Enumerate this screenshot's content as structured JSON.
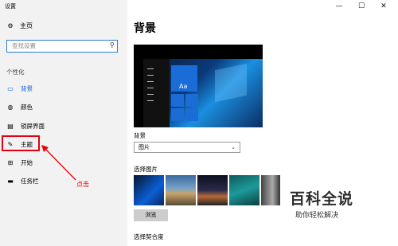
{
  "window": {
    "title": "设置",
    "min": "—",
    "max": "☐",
    "close": "✕"
  },
  "sidebar": {
    "home_label": "主页",
    "search_placeholder": "查找设置",
    "section_label": "个性化",
    "items": [
      {
        "label": "背景",
        "icon": "image-icon",
        "glyph": "▭"
      },
      {
        "label": "颜色",
        "icon": "palette-icon",
        "glyph": "◍"
      },
      {
        "label": "锁屏界面",
        "icon": "lock-screen-icon",
        "glyph": "▤"
      },
      {
        "label": "主题",
        "icon": "theme-icon",
        "glyph": "✎"
      },
      {
        "label": "开始",
        "icon": "start-icon",
        "glyph": "⊞"
      },
      {
        "label": "任务栏",
        "icon": "taskbar-icon",
        "glyph": "▬"
      }
    ]
  },
  "annotation": {
    "label": "点击"
  },
  "main": {
    "title": "背景",
    "preview_tile_label": "Aa",
    "background_label": "背景",
    "background_value": "图片",
    "choose_picture_label": "选择图片",
    "browse_label": "浏览",
    "fit_label": "选择契合度"
  },
  "watermark": {
    "main": "百科全说",
    "sub": "助你轻松解决"
  },
  "colors": {
    "accent": "#0b5fd6",
    "highlight": "#e60012",
    "sidebar_bg": "#f2f2f2"
  }
}
